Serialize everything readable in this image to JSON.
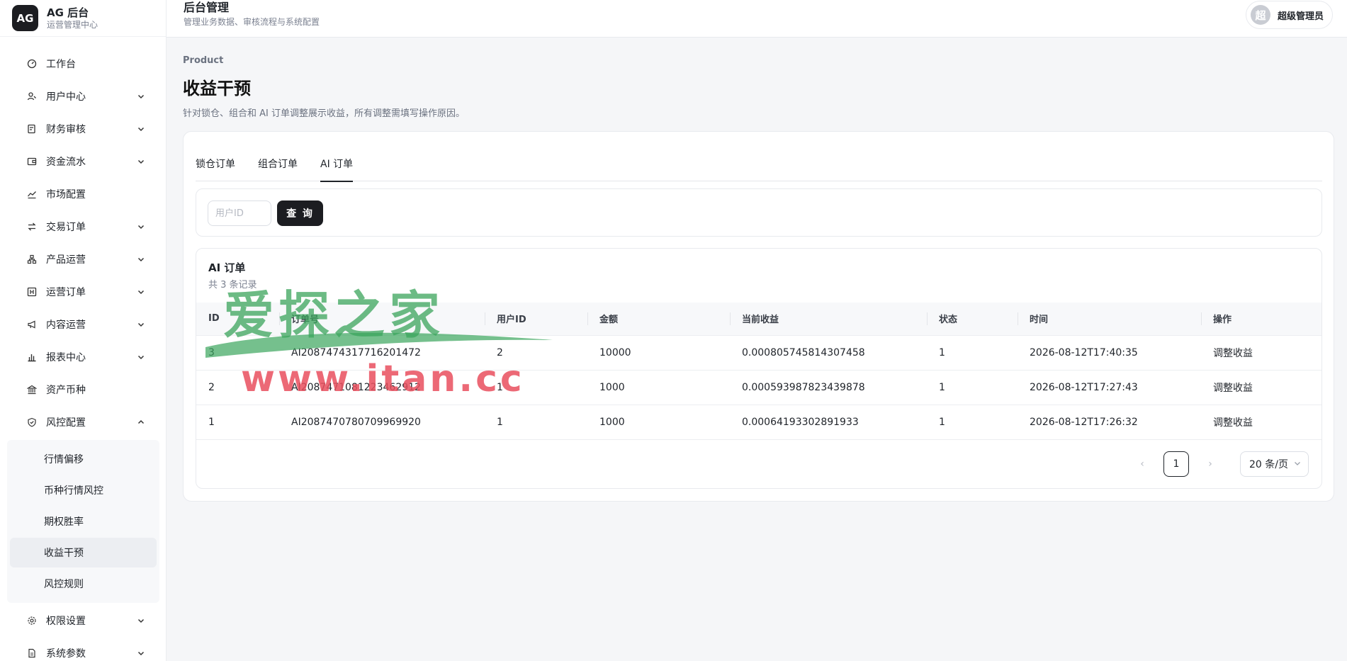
{
  "brand": {
    "logo": "AG",
    "name": "AG 后台",
    "subtitle": "运营管理中心"
  },
  "sidebar": {
    "items": [
      {
        "label": "工作台",
        "icon": "dashboard-icon",
        "expandable": false
      },
      {
        "label": "用户中心",
        "icon": "users-icon",
        "expandable": true
      },
      {
        "label": "财务审核",
        "icon": "audit-icon",
        "expandable": true
      },
      {
        "label": "资金流水",
        "icon": "wallet-icon",
        "expandable": true
      },
      {
        "label": "市场配置",
        "icon": "chart-line-icon",
        "expandable": false
      },
      {
        "label": "交易订单",
        "icon": "swap-icon",
        "expandable": true
      },
      {
        "label": "产品运营",
        "icon": "hierarchy-icon",
        "expandable": true
      },
      {
        "label": "运营订单",
        "icon": "ledger-icon",
        "expandable": true
      },
      {
        "label": "内容运营",
        "icon": "megaphone-icon",
        "expandable": true
      },
      {
        "label": "报表中心",
        "icon": "bar-chart-icon",
        "expandable": true
      },
      {
        "label": "资产币种",
        "icon": "bank-icon",
        "expandable": false
      },
      {
        "label": "风控配置",
        "icon": "shield-icon",
        "expandable": true,
        "expanded": true
      }
    ],
    "risk_submenu": [
      {
        "label": "行情偏移"
      },
      {
        "label": "币种行情风控"
      },
      {
        "label": "期权胜率"
      },
      {
        "label": "收益干预",
        "active": true
      },
      {
        "label": "风控规则"
      }
    ],
    "bottom_items": [
      {
        "label": "权限设置",
        "icon": "gear-icon"
      },
      {
        "label": "系统参数",
        "icon": "document-icon"
      }
    ]
  },
  "topbar": {
    "title": "后台管理",
    "subtitle": "管理业务数据、审核流程与系统配置"
  },
  "user": {
    "avatar_char": "超",
    "name": "超级管理员"
  },
  "page": {
    "breadcrumb": "Product",
    "title": "收益干预",
    "description": "针对锁仓、组合和 AI 订单调整展示收益，所有调整需填写操作原因。"
  },
  "tabs": [
    {
      "label": "锁仓订单",
      "active": false
    },
    {
      "label": "组合订单",
      "active": false
    },
    {
      "label": "AI 订单",
      "active": true
    }
  ],
  "filter": {
    "user_id_placeholder": "用户ID",
    "query_label": "查 询"
  },
  "table": {
    "title": "AI 订单",
    "count": "共 3 条记录",
    "columns": [
      "ID",
      "订单号",
      "用户ID",
      "金额",
      "当前收益",
      "状态",
      "时间",
      "操作"
    ],
    "rows": [
      [
        "3",
        "AI2087474317716201472",
        "2",
        "10000",
        "0.000805745814307458",
        "1",
        "2026-08-12T17:40:35",
        "调整收益"
      ],
      [
        "2",
        "AI2087471081223462912",
        "1",
        "1000",
        "0.000593987823439878",
        "1",
        "2026-08-12T17:27:43",
        "调整收益"
      ],
      [
        "1",
        "AI2087470780709969920",
        "1",
        "1000",
        "0.00064193302891933",
        "1",
        "2026-08-12T17:26:32",
        "调整收益"
      ]
    ]
  },
  "pagination": {
    "current_page": "1",
    "page_size": "20 条/页"
  },
  "watermark": {
    "top": "爱探之家",
    "bottom": "www.itan.cc"
  }
}
